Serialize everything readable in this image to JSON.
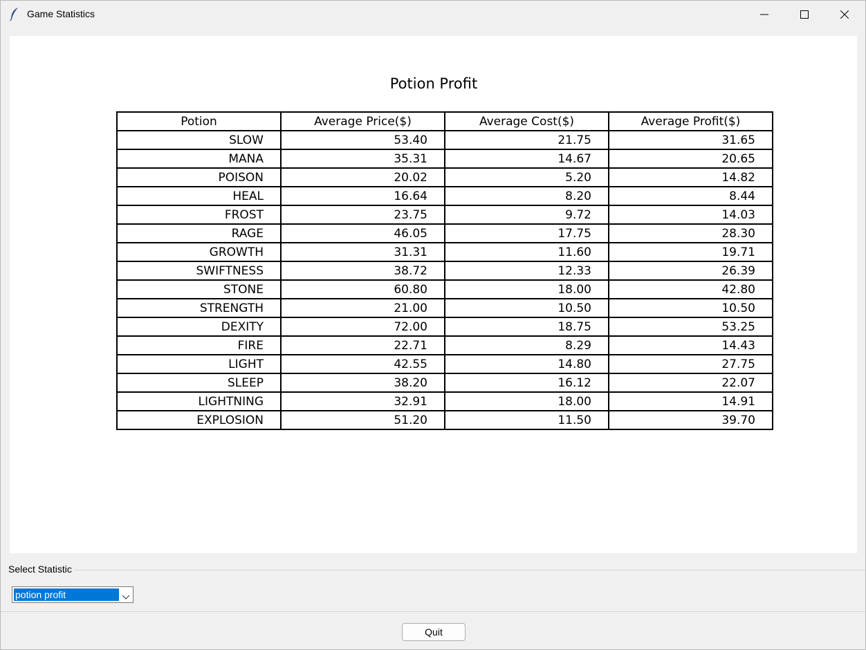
{
  "window": {
    "title": "Game Statistics",
    "icon": "feather-icon",
    "controls": [
      "minimize-icon",
      "maximize-icon",
      "close-icon"
    ]
  },
  "table": {
    "title": "Potion Profit",
    "headers": [
      "Potion",
      "Average Price($)",
      "Average Cost($)",
      "Average Profit($)"
    ],
    "rows": [
      [
        "SLOW",
        "53.40",
        "21.75",
        "31.65"
      ],
      [
        "MANA",
        "35.31",
        "14.67",
        "20.65"
      ],
      [
        "POISON",
        "20.02",
        "5.20",
        "14.82"
      ],
      [
        "HEAL",
        "16.64",
        "8.20",
        "8.44"
      ],
      [
        "FROST",
        "23.75",
        "9.72",
        "14.03"
      ],
      [
        "RAGE",
        "46.05",
        "17.75",
        "28.30"
      ],
      [
        "GROWTH",
        "31.31",
        "11.60",
        "19.71"
      ],
      [
        "SWIFTNESS",
        "38.72",
        "12.33",
        "26.39"
      ],
      [
        "STONE",
        "60.80",
        "18.00",
        "42.80"
      ],
      [
        "STRENGTH",
        "21.00",
        "10.50",
        "10.50"
      ],
      [
        "DEXITY",
        "72.00",
        "18.75",
        "53.25"
      ],
      [
        "FIRE",
        "22.71",
        "8.29",
        "14.43"
      ],
      [
        "LIGHT",
        "42.55",
        "14.80",
        "27.75"
      ],
      [
        "SLEEP",
        "38.20",
        "16.12",
        "22.07"
      ],
      [
        "LIGHTNING",
        "32.91",
        "18.00",
        "14.91"
      ],
      [
        "EXPLOSION",
        "51.20",
        "11.50",
        "39.70"
      ]
    ]
  },
  "controls": {
    "group_label": "Select Statistic",
    "select_value": "potion profit",
    "quit_label": "Quit"
  },
  "colors": {
    "selection": "#0078d7",
    "window_bg": "#f0f0f0",
    "canvas_bg": "#ffffff"
  }
}
